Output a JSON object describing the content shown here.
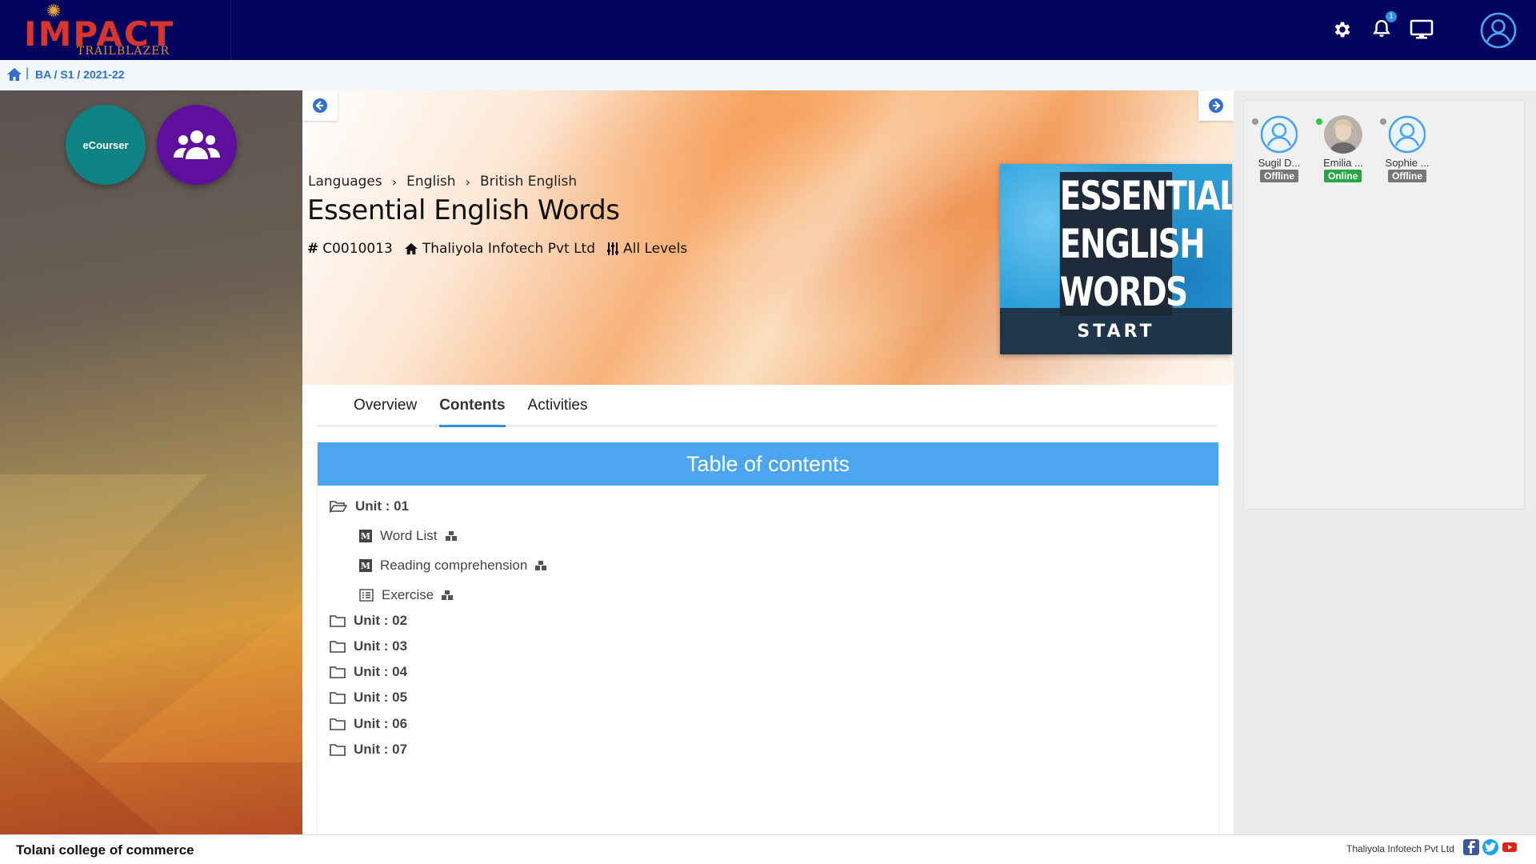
{
  "app": {
    "logo_text": "IMPACT",
    "logo_subtext": "TRAILBLAZER",
    "brand_color": "#03045e",
    "notification_count": "1"
  },
  "breadcrumb": {
    "path": "BA / S1 / 2021-22"
  },
  "left_panel": {
    "ecourser_label": "eCourser"
  },
  "course": {
    "crumbs": [
      "Languages",
      "English",
      "British English"
    ],
    "title": "Essential English Words",
    "code": "C0010013",
    "provider": "Thaliyola Infotech Pvt Ltd",
    "level": "All Levels",
    "thumbnail_lines": [
      "ESSENTIAL",
      "ENGLISH",
      "WORDS"
    ],
    "start_label": "START"
  },
  "tabs": [
    {
      "label": "Overview",
      "active": false
    },
    {
      "label": "Contents",
      "active": true
    },
    {
      "label": "Activities",
      "active": false
    }
  ],
  "toc": {
    "header": "Table of contents",
    "accent": "#4ba5ef",
    "unit_01": "Unit : 01",
    "lessons": [
      {
        "label": "Word List",
        "icon": "moodle-icon"
      },
      {
        "label": "Reading comprehension",
        "icon": "moodle-icon"
      },
      {
        "label": "Exercise",
        "icon": "list-icon"
      }
    ],
    "units": [
      "Unit : 02",
      "Unit : 03",
      "Unit : 04",
      "Unit : 05",
      "Unit : 06",
      "Unit : 07"
    ]
  },
  "users": [
    {
      "name": "Sugil D...",
      "status": "Offline",
      "status_color": "#777777"
    },
    {
      "name": "Emilia ...",
      "status": "Online",
      "status_color": "#28a745"
    },
    {
      "name": "Sophie ...",
      "status": "Offline",
      "status_color": "#777777"
    }
  ],
  "footer": {
    "college": "Tolani college of commerce",
    "company": "Thaliyola Infotech Pvt Ltd"
  }
}
